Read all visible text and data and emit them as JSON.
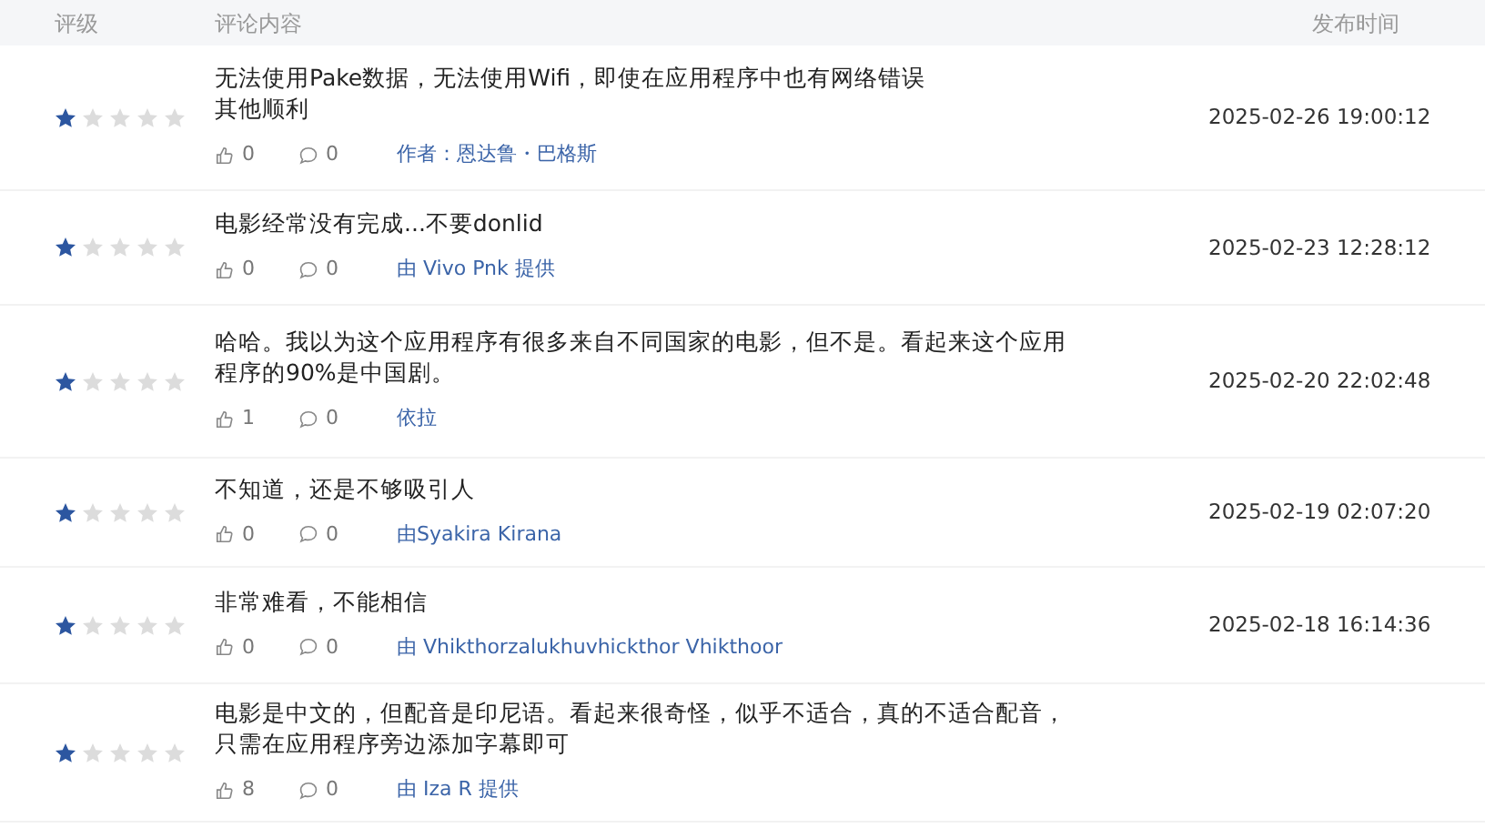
{
  "table": {
    "columns": [
      "评级",
      "评论内容",
      "发布时间"
    ],
    "rows": [
      {
        "stars": 1,
        "comment": "无法使用Pake数据，无法使用Wifi，即使在应用程序中也有网络错误",
        "comment_2": "其他顺利",
        "likes": "0",
        "replies": "0",
        "author": "作者：恩达鲁・巴格斯",
        "time": "2025-02-26 19:00:12"
      },
      {
        "stars": 1,
        "comment": "电影经常没有完成...不要donlid",
        "likes": "0",
        "replies": "0",
        "author": "由 Vivo Pnk 提供",
        "time": "2025-02-23 12:28:12"
      },
      {
        "stars": 1,
        "comment": "哈哈。我以为这个应用程序有很多来自不同国家的电影，但不是。看起来这个应用程序的90%是中国剧。",
        "likes": "1",
        "replies": "0",
        "author": "依拉",
        "time": "2025-02-20 22:02:48"
      },
      {
        "stars": 1,
        "comment": "不知道，还是不够吸引人",
        "likes": "0",
        "replies": "0",
        "author": "由Syakira Kirana",
        "time": "2025-02-19 02:07:20"
      },
      {
        "stars": 1,
        "comment": "非常难看，不能相信",
        "likes": "0",
        "replies": "0",
        "author": "由 Vhikthorzalukhuvhickthor Vhikthoor",
        "time": "2025-02-18 16:14:36"
      },
      {
        "stars": 1,
        "comment": "电影是中文的，但配音是印尼语。看起来很奇怪，似乎不适合，真的不适合配音，只需在应用程序旁边添加字幕即可",
        "likes": "8",
        "replies": "0",
        "author": "由 Iza R 提供"
      }
    ]
  }
}
